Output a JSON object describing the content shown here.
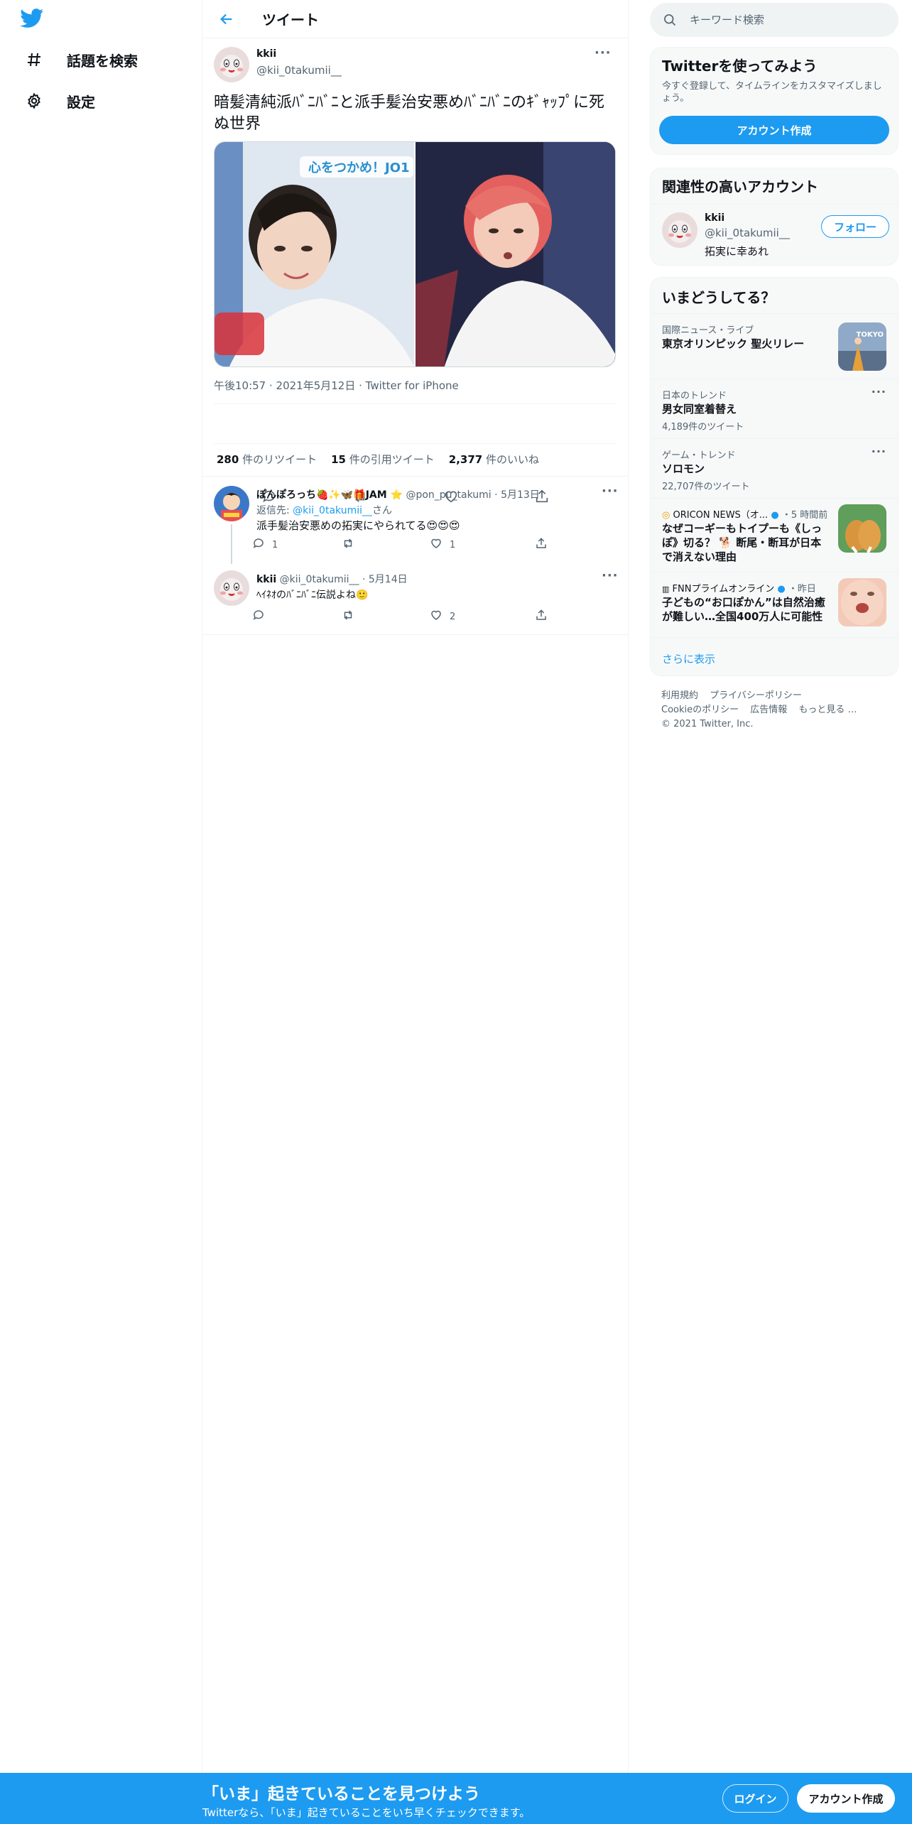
{
  "nav": {
    "items": [
      {
        "label": "話題を検索",
        "icon": "hashtag-icon"
      },
      {
        "label": "設定",
        "icon": "gear-icon"
      }
    ]
  },
  "header": {
    "title": "ツイート"
  },
  "tweet": {
    "author_name": "kkii",
    "author_handle": "@kii_0takumii__",
    "text": "暗髪清純派ﾊﾞﾆﾊﾞﾆと派手髪治安悪めﾊﾞﾆﾊﾞﾆのｷﾞｬｯﾌﾟに死ぬ世界",
    "media_caption": "心をつかめ！JO1",
    "time": "午後10:57",
    "date": "2021年5月12日",
    "source": "Twitter for iPhone",
    "retweets": "280",
    "retweets_label": "件のリツイート",
    "quotes": "15",
    "quotes_label": "件の引用ツイート",
    "likes": "2,377",
    "likes_label": "件のいいね"
  },
  "replies": [
    {
      "name": "ぽんぽろっち🍓✨🦋🎁JAM ⭐",
      "handle": "@pon_pu_takumi",
      "date": "5月13日",
      "reply_to_prefix": "返信先: ",
      "reply_to_handle": "@kii_0takumii__",
      "reply_to_suffix": "さん",
      "text": "派手髪治安悪めの拓実にやられてる😍😍😍",
      "reply_count": "1",
      "retweet_count": "",
      "like_count": "1"
    },
    {
      "name": "kkii",
      "handle": "@kii_0takumii__",
      "date": "5月14日",
      "text": "ﾍｲﾈｵのﾊﾞﾆﾊﾞﾆ伝説よね🙂",
      "reply_count": "",
      "retweet_count": "",
      "like_count": "2"
    }
  ],
  "search": {
    "placeholder": "キーワード検索"
  },
  "signup_card": {
    "title": "Twitterを使ってみよう",
    "subtitle": "今すぐ登録して、タイムラインをカスタマイズしましょう。",
    "button": "アカウント作成"
  },
  "related": {
    "title": "関連性の高いアカウント",
    "name": "kkii",
    "handle": "@kii_0takumii__",
    "bio": "拓実に幸あれ",
    "follow": "フォロー"
  },
  "trends": {
    "title": "いまどうしてる？",
    "items": [
      {
        "category": "国際ニュース・ライブ",
        "title": "東京オリンピック 聖火リレー",
        "count": "",
        "thumb_text": "TOKYO"
      },
      {
        "category": "日本のトレンド",
        "title": "男女同室着替え",
        "count": "4,189件のツイート"
      },
      {
        "category": "ゲーム・トレンド",
        "title": "ソロモン",
        "count": "22,707件のツイート"
      },
      {
        "category": "ORICON NEWS（オ...",
        "time": "・5 時間前",
        "title": "なぜコーギーもトイプーも《しっぽ》切る？ 🐕 断尾・断耳が日本で消えない理由"
      },
      {
        "category": "FNNプライムオンライン",
        "time": "・昨日",
        "title": "子どもの“お口ぽかん”は自然治癒が難しい…全国400万人に可能性"
      }
    ],
    "show_more": "さらに表示"
  },
  "footer": {
    "links": [
      "利用規約",
      "プライバシーポリシー",
      "Cookieのポリシー",
      "広告情報",
      "もっと見る …"
    ],
    "copyright": "© 2021 Twitter, Inc."
  },
  "bottom_bar": {
    "title": "「いま」起きていることを見つけよう",
    "subtitle": "Twitterなら、「いま」起きていることをいち早くチェックできます。",
    "login": "ログイン",
    "signup": "アカウント作成"
  },
  "colors": {
    "accent": "#1d9bf0",
    "text": "#0f1419",
    "muted": "#536471",
    "border": "#eff3f4"
  }
}
